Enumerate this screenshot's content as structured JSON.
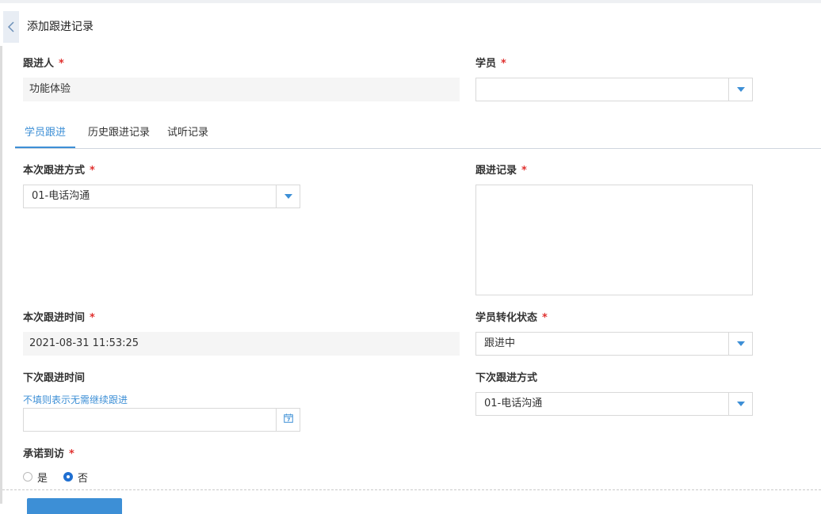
{
  "header": {
    "title": "添加跟进记录"
  },
  "fields": {
    "follower": {
      "label": "跟进人",
      "required": "*",
      "value": "功能体验"
    },
    "student": {
      "label": "学员",
      "required": "*",
      "value": ""
    },
    "method": {
      "label": "本次跟进方式",
      "required": "*",
      "value": "01-电话沟通"
    },
    "record": {
      "label": "跟进记录",
      "required": "*"
    },
    "time": {
      "label": "本次跟进时间",
      "required": "*",
      "value": "2021-08-31 11:53:25"
    },
    "status": {
      "label": "学员转化状态",
      "required": "*",
      "value": "跟进中"
    },
    "next_time": {
      "label": "下次跟进时间",
      "hint": "不填则表示无需继续跟进",
      "value": ""
    },
    "next_method": {
      "label": "下次跟进方式",
      "value": "01-电话沟通"
    },
    "promise": {
      "label": "承诺到访",
      "required": "*",
      "options": [
        "是",
        "否"
      ],
      "selected": "否"
    }
  },
  "tabs": [
    {
      "label": "学员跟进",
      "active": true
    },
    {
      "label": "历史跟进记录",
      "active": false
    },
    {
      "label": "试听记录",
      "active": false
    }
  ],
  "colors": {
    "accent": "#3d8fd6",
    "required": "#e0312f",
    "radio_selected": "#1f6fd1"
  },
  "icons": {
    "back": "chevron-left-icon",
    "dropdown": "caret-down-icon",
    "calendar": "calendar-icon"
  }
}
